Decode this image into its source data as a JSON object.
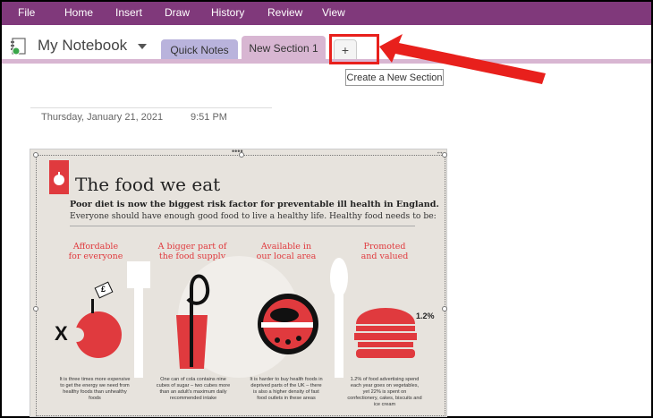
{
  "menu": [
    "File",
    "Home",
    "Insert",
    "Draw",
    "History",
    "Review",
    "View"
  ],
  "notebook": {
    "title": "My Notebook"
  },
  "tabs": {
    "quick_notes": "Quick Notes",
    "new_section": "New Section 1",
    "add": "+"
  },
  "tooltip": "Create a New Section",
  "page": {
    "date": "Thursday, January 21, 2021",
    "time": "9:51 PM"
  },
  "infographic": {
    "title": "The food we eat",
    "bold_line": "Poor diet is now the biggest risk factor for preventable ill health in England.",
    "sub_line": "Everyone should have enough good food to live a healthy life. Healthy food needs to be:",
    "categories": [
      {
        "line1": "Affordable",
        "line2": "for everyone"
      },
      {
        "line1": "A bigger part of",
        "line2": "the food supply"
      },
      {
        "line1": "Available in",
        "line2": "our local area"
      },
      {
        "line1": "Promoted",
        "line2": "and valued"
      }
    ],
    "descriptions": [
      "It is three times more expensive to get the energy we need from healthy foods than unhealthy foods",
      "One can of cola contains nine cubes of sugar – two cubes more than an adult's maximum daily recommended intake",
      "It is harder to buy health foods in deprived parts of the UK – there is also a higher density of fast food outlets in these areas",
      "1.2% of food advertising spend each year goes on vegetables, yet 22% is spent on confectionery, cakes, biscuits and ice cream"
    ],
    "percent": "1.2%",
    "x_mark": "X",
    "price_tag": "£"
  },
  "colors": {
    "menubar": "#80397b",
    "accent_red": "#e03a3e",
    "tab_active": "#d8b6d2",
    "tab_quick": "#b9b3dc"
  }
}
